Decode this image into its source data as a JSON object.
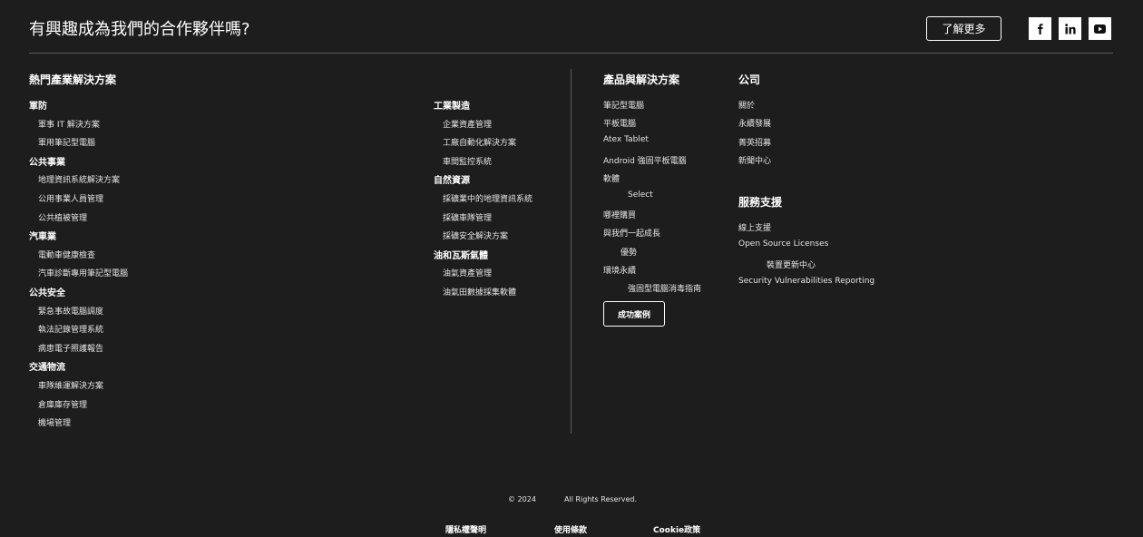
{
  "cta": {
    "headline": "有興趣成為我們的合作夥伴嗎?",
    "button_label": "了解更多"
  },
  "social": [
    {
      "name": "facebook-icon",
      "glyph": "f"
    },
    {
      "name": "linkedin-icon",
      "glyph": "in"
    },
    {
      "name": "youtube-icon",
      "glyph": "play"
    }
  ],
  "industry": {
    "title": "熱門產業解決方案",
    "col1": [
      {
        "type": "group",
        "label": "軍防"
      },
      {
        "type": "link",
        "label": "軍事 IT 解決方案"
      },
      {
        "type": "link",
        "label": "軍用筆記型電腦"
      },
      {
        "type": "group",
        "label": "公共事業"
      },
      {
        "type": "link",
        "label": "地理資訊系統解決方案"
      },
      {
        "type": "link",
        "label": "公用事業人員管理"
      },
      {
        "type": "link",
        "label": "公共植被管理"
      },
      {
        "type": "group",
        "label": "汽車業"
      },
      {
        "type": "link",
        "label": "電動車健康檢查"
      },
      {
        "type": "link",
        "label": "汽車診斷專用筆記型電腦"
      },
      {
        "type": "group",
        "label": "公共安全"
      },
      {
        "type": "link",
        "label": "緊急事故電腦調度"
      },
      {
        "type": "link",
        "label": "執法記錄管理系統"
      },
      {
        "type": "link",
        "label": "病患電子照護報告"
      },
      {
        "type": "group",
        "label": "交通物流"
      },
      {
        "type": "link",
        "label": "車隊維運解決方案"
      },
      {
        "type": "link",
        "label": "倉庫庫存管理"
      },
      {
        "type": "link",
        "label": "機場管理"
      }
    ],
    "col2": [
      {
        "type": "group",
        "label": "工業製造"
      },
      {
        "type": "link",
        "label": "企業資產管理"
      },
      {
        "type": "link",
        "label": "工廠自動化解決方案"
      },
      {
        "type": "link",
        "label": "車間監控系統"
      },
      {
        "type": "group",
        "label": "自然資源"
      },
      {
        "type": "link",
        "label": "採礦業中的地理資訊系統"
      },
      {
        "type": "link",
        "label": "採礦車隊管理"
      },
      {
        "type": "link",
        "label": "採礦安全解決方案"
      },
      {
        "type": "group",
        "label": "油和瓦斯氣體"
      },
      {
        "type": "link",
        "label": "油氣資產管理"
      },
      {
        "type": "link",
        "label": "油氣田數據採集軟體"
      }
    ]
  },
  "products": {
    "title": "產品與解決方案",
    "items": [
      {
        "label": "筆記型電腦",
        "indent": 0
      },
      {
        "label": "平板電腦",
        "indent": 0
      },
      {
        "label": "Atex Tablet",
        "indent": 0
      },
      {
        "label": "Android 強固平板電腦",
        "indent": 0
      },
      {
        "label": "軟體",
        "indent": 0
      },
      {
        "label": "Select",
        "indent": 27
      },
      {
        "label": "哪裡購買",
        "indent": 0
      },
      {
        "label": "與我們一起成長",
        "indent": 0
      },
      {
        "label": "優勢",
        "indent": 19
      },
      {
        "label": "環境永續",
        "indent": 0
      },
      {
        "label": "強固型電腦消毒指南",
        "indent": 27
      }
    ],
    "case_button": "成功案例"
  },
  "company": {
    "title": "公司",
    "items": [
      "關於",
      "永續發展",
      "菁英招募",
      "新聞中心"
    ]
  },
  "support": {
    "title": "服務支援",
    "items": [
      {
        "label": "線上支援",
        "indent": 0
      },
      {
        "label": "Open Source Licenses",
        "indent": 0
      },
      {
        "label": "裝置更新中心",
        "indent": 31
      },
      {
        "label": "Security Vulnerabilities Reporting",
        "indent": 0
      }
    ]
  },
  "footer": {
    "year": "© 2024",
    "rights": "All Rights Reserved.",
    "links": [
      "隱私權聲明",
      "使用條款",
      "Cookie政策"
    ]
  }
}
